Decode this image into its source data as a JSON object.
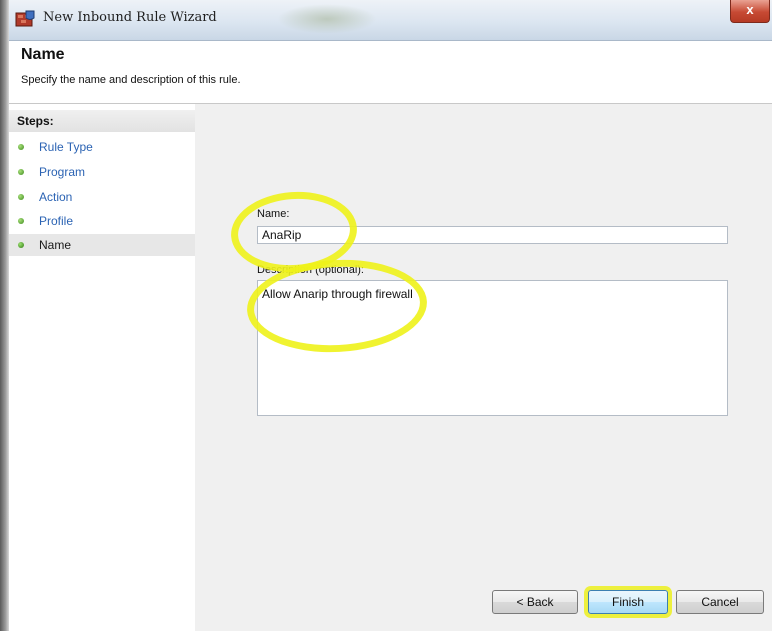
{
  "window": {
    "title": "New Inbound Rule Wizard",
    "close_glyph": "x"
  },
  "header": {
    "title": "Name",
    "subtitle": "Specify the name and description of this rule."
  },
  "sidebar": {
    "heading": "Steps:",
    "items": [
      {
        "label": "Rule Type",
        "current": false
      },
      {
        "label": "Program",
        "current": false
      },
      {
        "label": "Action",
        "current": false
      },
      {
        "label": "Profile",
        "current": false
      },
      {
        "label": "Name",
        "current": true
      }
    ]
  },
  "form": {
    "name_label": "Name:",
    "name_value": "AnaRip",
    "description_label": "Description (optional):",
    "description_value": "Allow Anarip through firewall"
  },
  "buttons": {
    "back": "< Back",
    "finish": "Finish",
    "cancel": "Cancel"
  },
  "colors": {
    "highlight": "#eef21a",
    "step_link": "#2b63b3",
    "step_bullet": "#3e8a1e",
    "close_button": "#c74a34"
  },
  "icons": {
    "app": "firewall-icon",
    "step_bullet": "green-dot-icon"
  }
}
